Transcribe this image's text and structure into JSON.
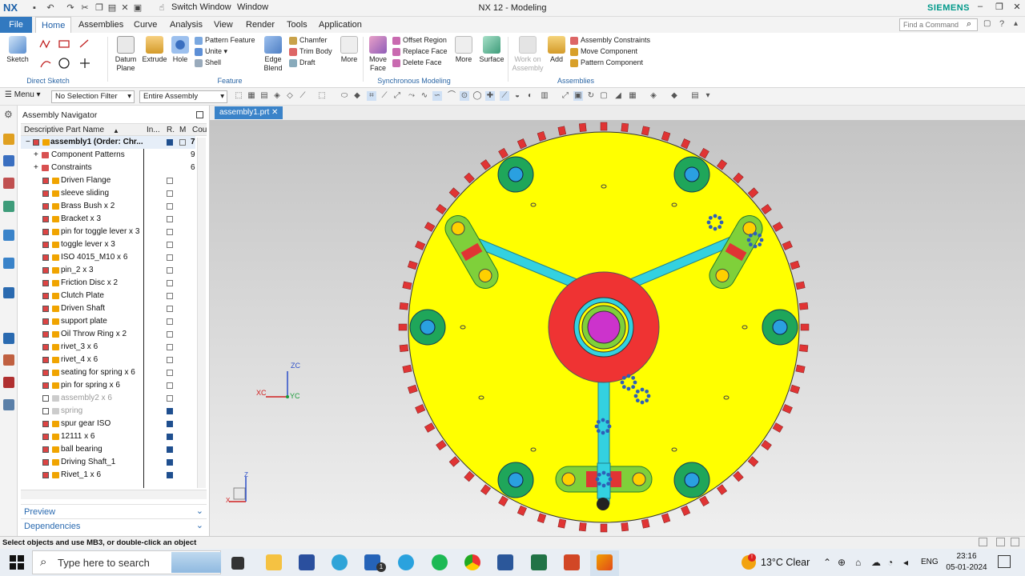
{
  "titlebar": {
    "app_logo": "NX",
    "switch_window": "Switch Window",
    "window_menu": "Window",
    "title": "NX 12 - Modeling",
    "brand": "SIEMENS"
  },
  "menu": {
    "file": "File",
    "tabs": [
      "Home",
      "Assemblies",
      "Curve",
      "Analysis",
      "View",
      "Render",
      "Tools",
      "Application"
    ],
    "active": "Home",
    "search_placeholder": "Find a Command"
  },
  "ribbon": {
    "sketch": "Sketch",
    "groups": {
      "direct_sketch": "Direct Sketch",
      "feature": "Feature",
      "synchronous_modeling": "Synchronous Modeling",
      "assemblies": "Assemblies"
    },
    "feature_big": {
      "datum_plane": "Datum Plane",
      "extrude": "Extrude",
      "hole": "Hole",
      "edge_blend": "Edge Blend",
      "more": "More"
    },
    "feature_small": {
      "pattern_feature": "Pattern Feature",
      "unite": "Unite",
      "shell": "Shell",
      "chamfer": "Chamfer",
      "trim_body": "Trim Body",
      "draft": "Draft"
    },
    "sync_big": {
      "move_face": "Move Face",
      "more": "More",
      "surface": "Surface"
    },
    "sync_small": {
      "offset_region": "Offset Region",
      "replace_face": "Replace Face",
      "delete_face": "Delete Face"
    },
    "asm_big": {
      "work_on_assembly": "Work on Assembly",
      "add": "Add"
    },
    "asm_small": {
      "assembly_constraints": "Assembly Constraints",
      "move_component": "Move Component",
      "pattern_component": "Pattern Component"
    }
  },
  "selection": {
    "menu": "Menu",
    "filter": "No Selection Filter",
    "scope": "Entire Assembly"
  },
  "navigator": {
    "title": "Assembly Navigator",
    "columns": [
      "Descriptive Part Name",
      "In...",
      "R.",
      "M",
      "Cou"
    ],
    "root": {
      "label": "assembly1 (Order: Chr...",
      "count": "7"
    },
    "nodes": [
      {
        "label": "Component Patterns",
        "count": "9"
      },
      {
        "label": "Constraints",
        "count": "6"
      }
    ],
    "items": [
      {
        "label": "Driven Flange",
        "saved": false,
        "on": true
      },
      {
        "label": "sleeve sliding",
        "saved": false,
        "on": true
      },
      {
        "label": "Brass Bush x 2",
        "saved": false,
        "on": true
      },
      {
        "label": "Bracket x 3",
        "saved": false,
        "on": true
      },
      {
        "label": "pin for toggle lever x 3",
        "saved": false,
        "on": true
      },
      {
        "label": "toggle lever x 3",
        "saved": false,
        "on": true
      },
      {
        "label": "ISO 4015_M10 x 6",
        "saved": false,
        "on": true
      },
      {
        "label": "pin_2 x 3",
        "saved": false,
        "on": true
      },
      {
        "label": "Friction Disc x 2",
        "saved": false,
        "on": true
      },
      {
        "label": "Clutch Plate",
        "saved": false,
        "on": true
      },
      {
        "label": "Driven Shaft",
        "saved": false,
        "on": true
      },
      {
        "label": "support plate",
        "saved": false,
        "on": true
      },
      {
        "label": "Oil Throw Ring x 2",
        "saved": false,
        "on": true
      },
      {
        "label": "rivet_3 x 6",
        "saved": false,
        "on": true
      },
      {
        "label": "rivet_4 x 6",
        "saved": false,
        "on": true
      },
      {
        "label": "seating for spring x 6",
        "saved": false,
        "on": true
      },
      {
        "label": "pin for spring x 6",
        "saved": false,
        "on": true
      },
      {
        "label": "assembly2 x 6",
        "saved": false,
        "on": false
      },
      {
        "label": "spring",
        "saved": true,
        "on": false
      },
      {
        "label": "spur gear ISO",
        "saved": true,
        "on": true
      },
      {
        "label": "12111 x 6",
        "saved": true,
        "on": true
      },
      {
        "label": "ball bearing",
        "saved": true,
        "on": true
      },
      {
        "label": "Driving Shaft_1",
        "saved": true,
        "on": true
      },
      {
        "label": "Rivet_1 x 6",
        "saved": true,
        "on": true
      }
    ],
    "preview": "Preview",
    "dependencies": "Dependencies"
  },
  "graphics": {
    "tab": "assembly1.prt",
    "axes": {
      "zc": "ZC",
      "xc": "XC",
      "yc": "YC",
      "z": "Z",
      "x": "X"
    },
    "colors": {
      "plate": "#ffff00",
      "hub": "#ef3333",
      "cyan": "#33d1e0",
      "green": "#1fa65a",
      "bolt_blue": "#2e5fb8",
      "tooth": "#e03434"
    }
  },
  "status": {
    "message": "Select objects and use MB3, or double-click an object"
  },
  "taskbar": {
    "search": "Type here to search",
    "weather": "13°C  Clear",
    "lang": "ENG",
    "time": "23:16",
    "date": "05-01-2024",
    "mail_badge": "1"
  }
}
